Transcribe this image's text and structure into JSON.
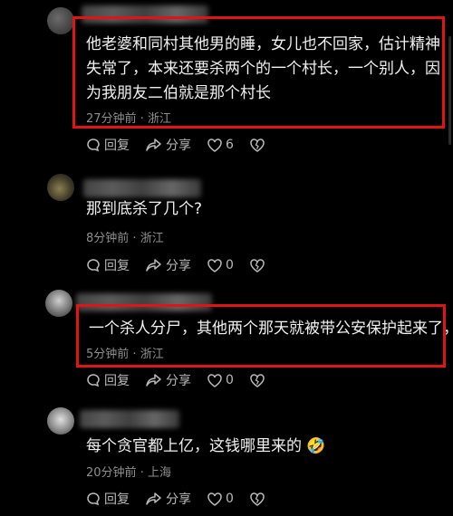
{
  "comments": [
    {
      "text": "他老婆和同村其他男的睡，女儿也不回家，估计精神失常了，本来还要杀两个的一个村长，一个别人，因为我朋友二伯就是那个村长",
      "time": "27分钟前",
      "location": "浙江",
      "reply_label": "回复",
      "share_label": "分享",
      "likes": "6",
      "highlighted": true
    },
    {
      "text": "那到底杀了几个?",
      "time": "8分钟前",
      "location": "浙江",
      "reply_label": "回复",
      "share_label": "分享",
      "likes": "0",
      "highlighted": false
    },
    {
      "text": "一个杀人分尸，其他两个那天就被带公安保护起来了，",
      "time": "5分钟前",
      "location": "浙江",
      "reply_label": "回复",
      "share_label": "分享",
      "likes": "0",
      "highlighted": true
    },
    {
      "text": "每个贪官都上亿，这钱哪里来的",
      "emoji": "🤣",
      "time": "20分钟前",
      "location": "上海",
      "reply_label": "回复",
      "share_label": "分享",
      "likes": "0",
      "highlighted": false
    }
  ],
  "meta_separator": "·",
  "colors": {
    "highlight": "#e01414",
    "background": "#000000"
  }
}
